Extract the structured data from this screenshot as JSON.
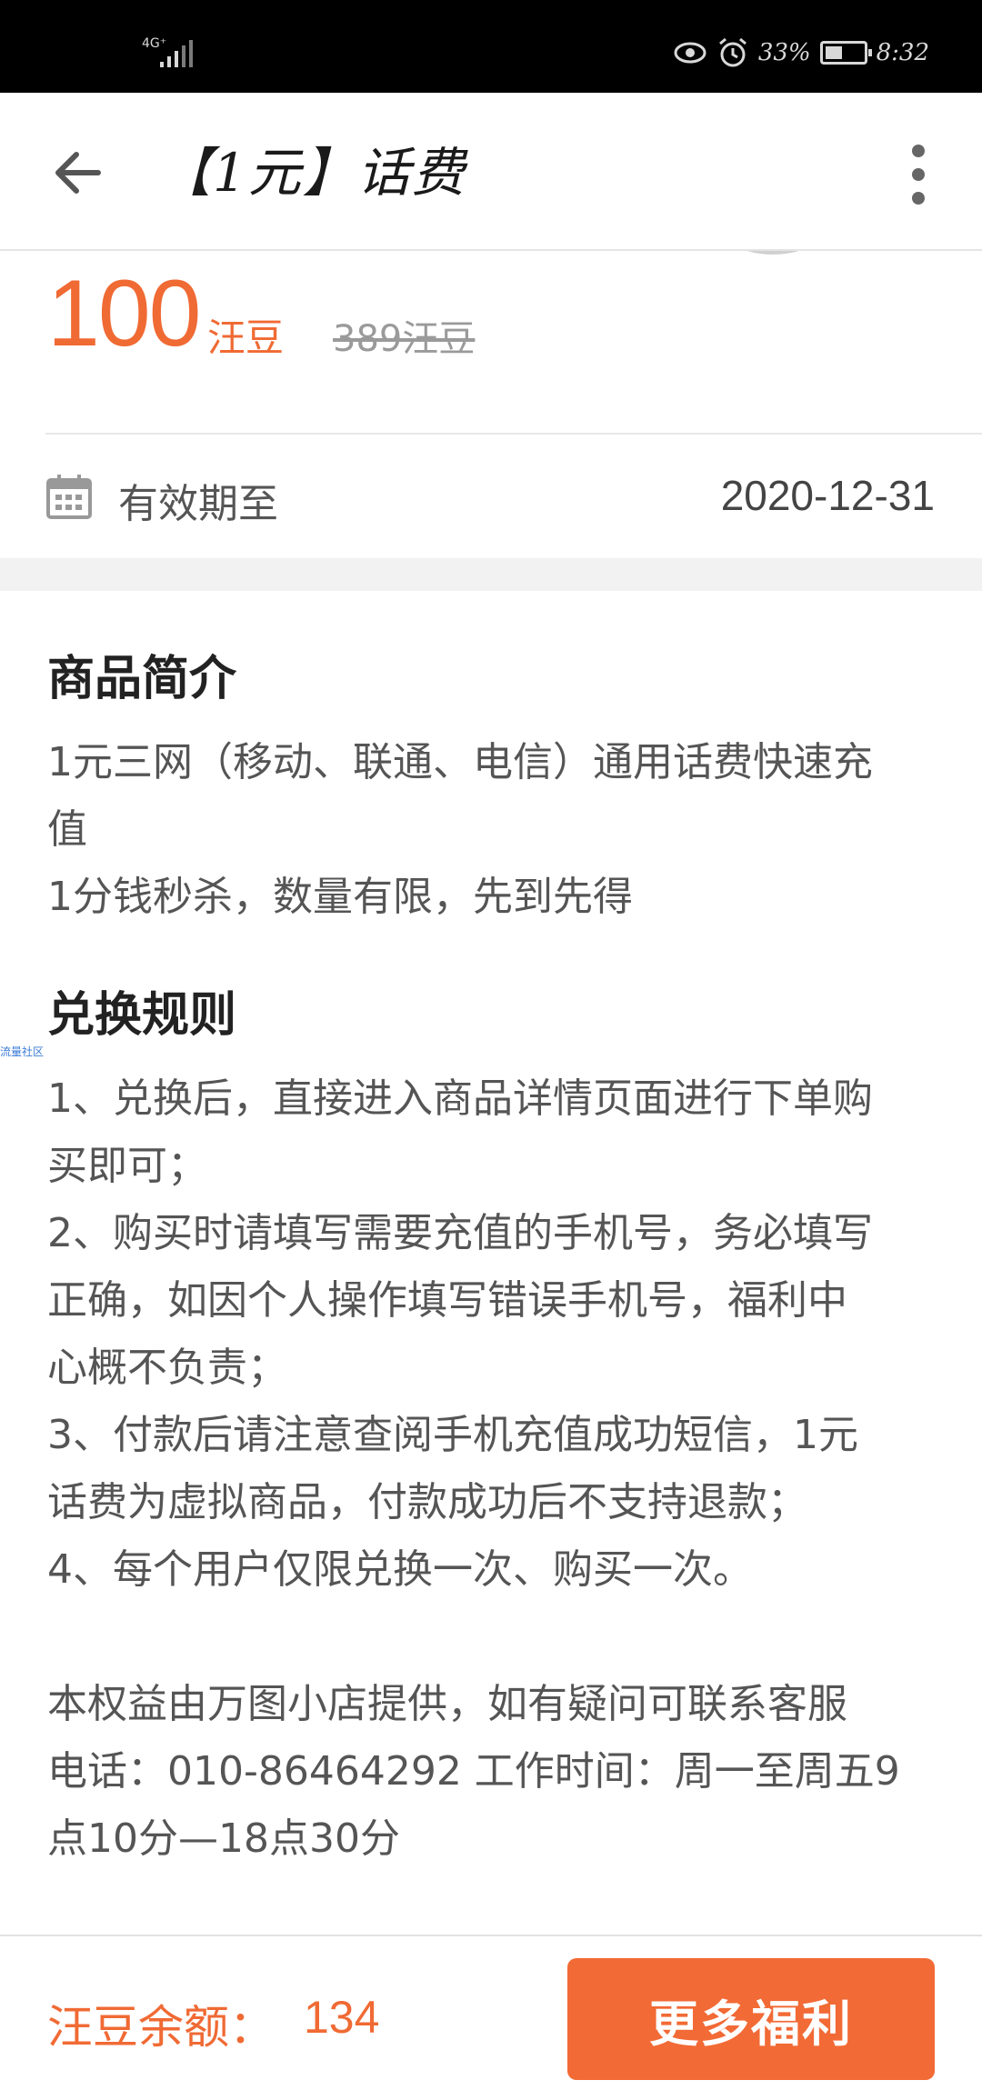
{
  "status_bar": {
    "network": "4G⁺",
    "battery": "33%",
    "time": "8:32",
    "icons": [
      "signal-icon",
      "eye-icon",
      "alarm-icon",
      "battery-icon"
    ]
  },
  "nav": {
    "title": "【1元】话费",
    "icons": [
      "back-arrow-icon",
      "more-vertical-icon"
    ]
  },
  "price": {
    "amount": "100",
    "unit": "汪豆",
    "original": "389汪豆"
  },
  "validity": {
    "label": "有效期至",
    "date": "2020-12-31"
  },
  "intro": {
    "title": "商品简介",
    "text": "1元三网（移动、联通、电信）通用话费快速充\n值\n1分钱秒杀，数量有限，先到先得"
  },
  "rules": {
    "title": "兑换规则",
    "text": "1、兑换后，直接进入商品详情页面进行下单购\n买即可；\n2、购买时请填写需要充值的手机号，务必填写\n正确，如因个人操作填写错误手机号，福利中\n心概不负责；\n3、付款后请注意查阅手机充值成功短信，1元\n话费为虚拟商品，付款成功后不支持退款；\n4、每个用户仅限兑换一次、购买一次。\n\n本权益由万图小店提供，如有疑问可联系客服\n电话：010-86464292 工作时间：周一至周五9\n点10分—18点30分"
  },
  "watermark": "流量社区",
  "bottom": {
    "balance_label": "汪豆余额：",
    "balance_value": "134",
    "button_label": "更多福利"
  },
  "colors": {
    "accent": "#f06a34",
    "button": "#f26a35",
    "status_bar": "#000000"
  }
}
